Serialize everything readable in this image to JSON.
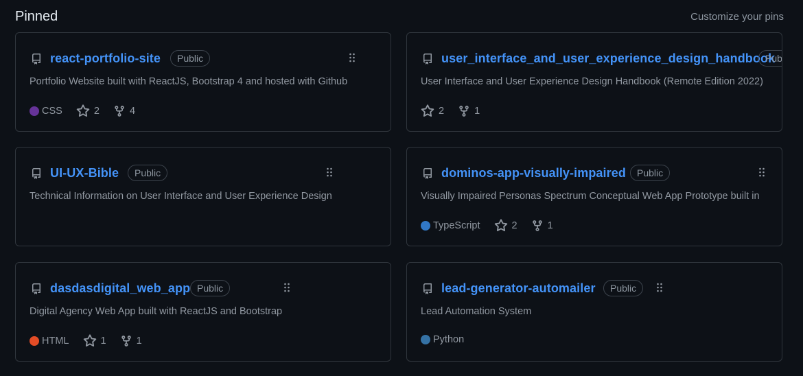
{
  "header": {
    "title": "Pinned",
    "customize": "Customize your pins"
  },
  "colors": {
    "css": "#663399",
    "typescript": "#3178c6",
    "html": "#e34c26",
    "python": "#3572A5",
    "link": "#4493f8"
  },
  "cards": [
    {
      "name": "react-portfolio-site",
      "visibility": "Public",
      "description": "Portfolio Website built with ReactJS, Bootstrap 4 and hosted with Github",
      "language": "CSS",
      "stars": "2",
      "forks": "4"
    },
    {
      "name": "user_interface_and_user_experience_design_handbook",
      "visibility": "Public",
      "description": "User Interface and User Experience Design Handbook (Remote Edition 2022)",
      "stars": "2",
      "forks": "1"
    },
    {
      "name": "UI-UX-Bible",
      "visibility": "Public",
      "description": "Technical Information on User Interface and User Experience Design"
    },
    {
      "name": "dominos-app-visually-impaired",
      "visibility": "Public",
      "description": "Visually Impaired Personas Spectrum Conceptual Web App Prototype built in",
      "language": "TypeScript",
      "stars": "2",
      "forks": "1"
    },
    {
      "name": "dasdasdigital_web_app",
      "visibility": "Public",
      "description": "Digital Agency Web App built with ReactJS and Bootstrap",
      "language": "HTML",
      "stars": "1",
      "forks": "1"
    },
    {
      "name": "lead-generator-automailer",
      "visibility": "Public",
      "description": "Lead Automation System",
      "language": "Python"
    }
  ]
}
